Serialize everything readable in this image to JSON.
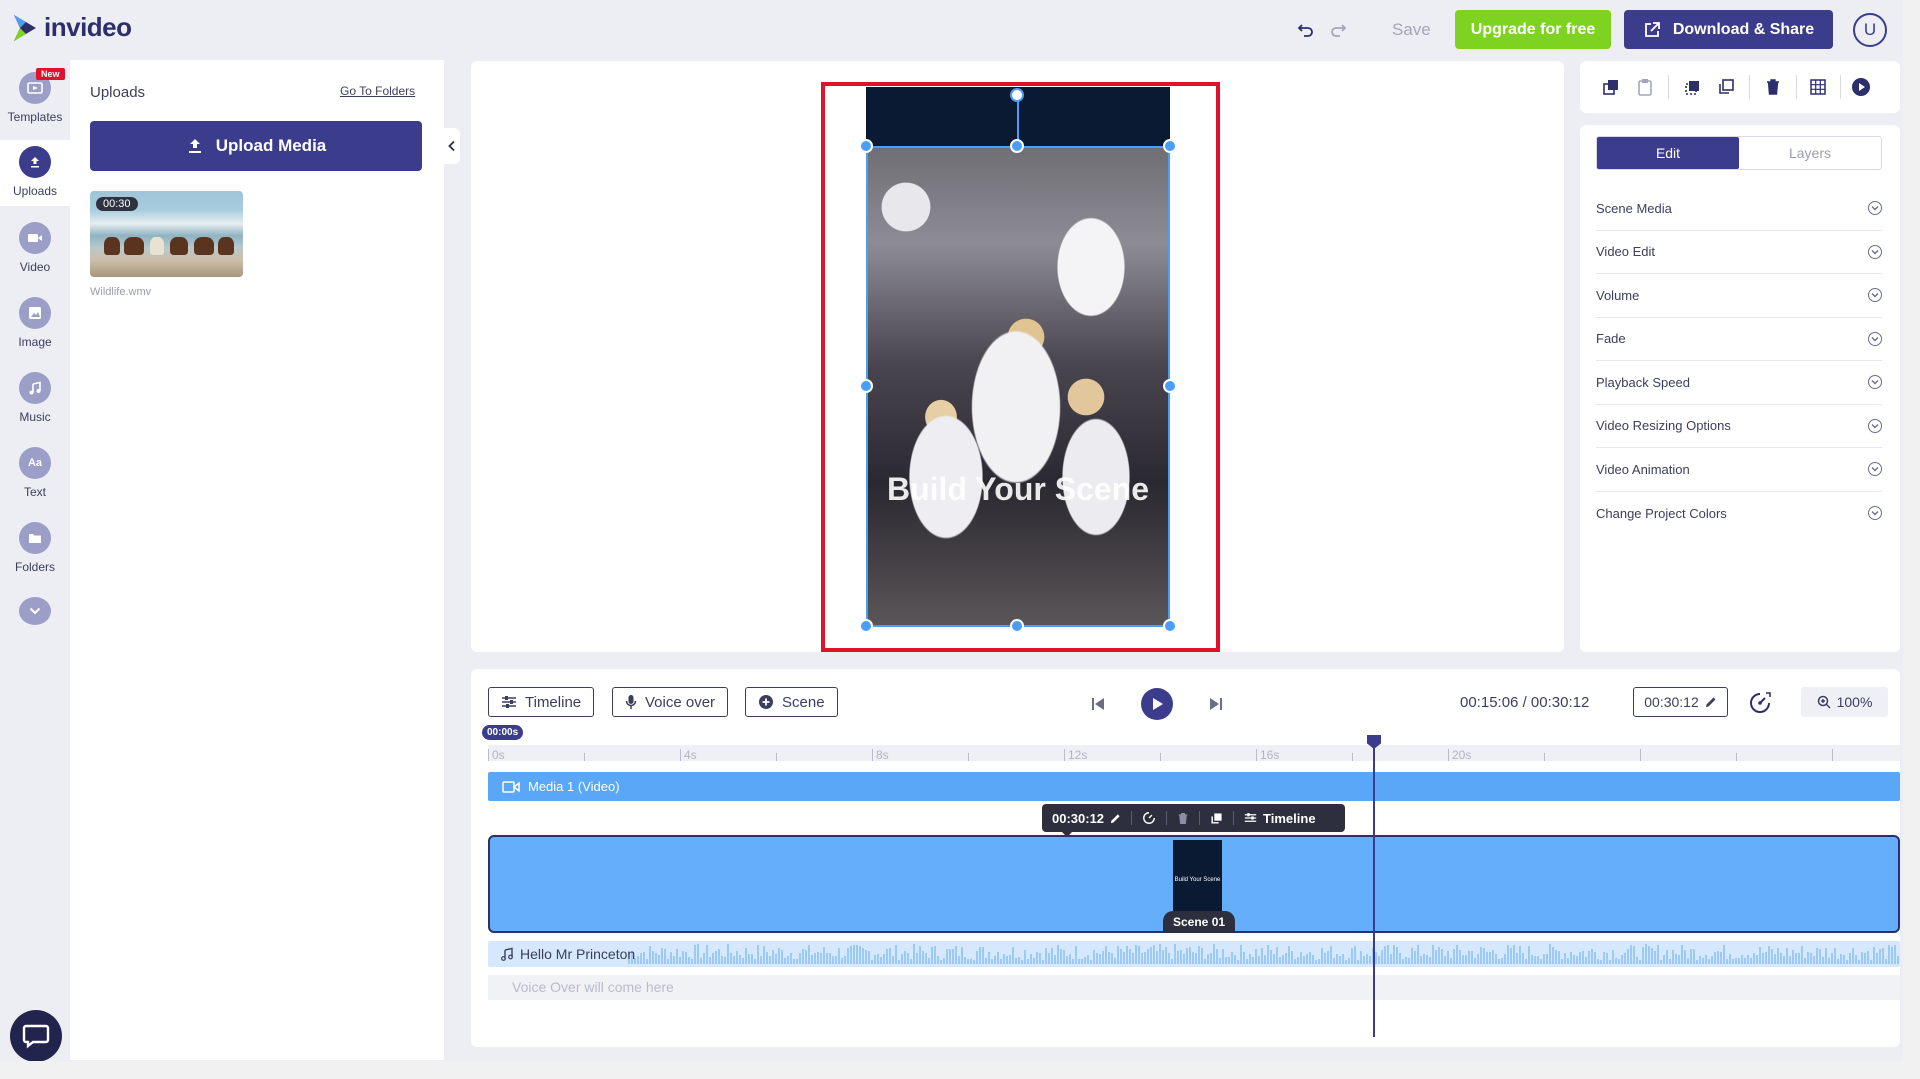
{
  "app": {
    "name": "invideo"
  },
  "toolbar": {
    "save_label": "Save",
    "upgrade_label": "Upgrade for free",
    "download_label": "Download & Share",
    "user_initial": "U"
  },
  "rail": {
    "new_badge": "New",
    "items": [
      {
        "label": "Templates",
        "icon": "templates-icon"
      },
      {
        "label": "Uploads",
        "icon": "upload-icon"
      },
      {
        "label": "Video",
        "icon": "video-icon"
      },
      {
        "label": "Image",
        "icon": "image-icon"
      },
      {
        "label": "Music",
        "icon": "music-icon"
      },
      {
        "label": "Text",
        "icon": "text-icon",
        "glyph": "Aa"
      },
      {
        "label": "Folders",
        "icon": "folder-icon"
      }
    ]
  },
  "uploads": {
    "title": "Uploads",
    "goto_folders": "Go To Folders",
    "upload_button": "Upload Media",
    "file": {
      "duration": "00:30",
      "name": "Wildlife.wmv"
    }
  },
  "canvas": {
    "scene_text": "Build Your Scene"
  },
  "properties": {
    "tabs": [
      {
        "label": "Edit",
        "active": true
      },
      {
        "label": "Layers",
        "active": false
      }
    ],
    "items": [
      "Scene Media",
      "Video Edit",
      "Volume",
      "Fade",
      "Playback Speed",
      "Video Resizing Options",
      "Video Animation",
      "Change Project Colors"
    ]
  },
  "timeline": {
    "buttons": {
      "timeline": "Timeline",
      "voice_over": "Voice over",
      "scene": "Scene"
    },
    "current_time": "00:15:06",
    "separator": "/",
    "total_time": "00:30:12",
    "duration_value": "00:30:12",
    "zoom": "100%",
    "playhead_label": "00:00s",
    "ruler_labels": [
      "0s",
      "4s",
      "8s",
      "12s",
      "16s",
      "20s"
    ],
    "media_track_label": "Media 1 (Video)",
    "clip_toolbar": {
      "duration": "00:30:12",
      "timeline_label": "Timeline"
    },
    "scene_label": "Scene 01",
    "scene_thumb_text": "Build Your Scene",
    "audio_label": "Hello Mr Princeton",
    "voiceover_placeholder": "Voice Over will come here"
  },
  "colors": {
    "primary": "#3b3c8c",
    "upgrade": "#7ed321",
    "selection": "#4a9ef5",
    "frame": "#e0112b",
    "track": "#5aa6f7"
  }
}
